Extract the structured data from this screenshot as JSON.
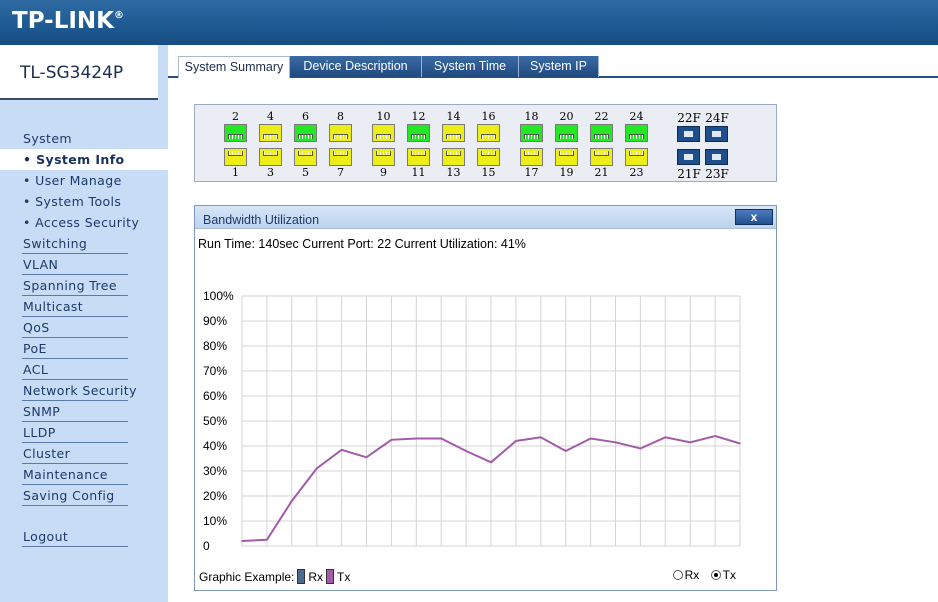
{
  "header": {
    "logo": "TP-LINK",
    "logo_reg": "®"
  },
  "sidebar": {
    "model": "TL-SG3424P",
    "items": [
      {
        "label": "System",
        "kind": "top",
        "line": false
      },
      {
        "label": "• System Info",
        "kind": "sub",
        "active": true
      },
      {
        "label": "• User Manage",
        "kind": "sub"
      },
      {
        "label": "• System Tools",
        "kind": "sub"
      },
      {
        "label": "• Access Security",
        "kind": "sub"
      },
      {
        "label": "Switching",
        "kind": "top"
      },
      {
        "label": "VLAN",
        "kind": "top"
      },
      {
        "label": "Spanning Tree",
        "kind": "top"
      },
      {
        "label": "Multicast",
        "kind": "top"
      },
      {
        "label": "QoS",
        "kind": "top"
      },
      {
        "label": "PoE",
        "kind": "top"
      },
      {
        "label": "ACL",
        "kind": "top"
      },
      {
        "label": "Network Security",
        "kind": "top"
      },
      {
        "label": "SNMP",
        "kind": "top"
      },
      {
        "label": "LLDP",
        "kind": "top"
      },
      {
        "label": "Cluster",
        "kind": "top"
      },
      {
        "label": "Maintenance",
        "kind": "top"
      },
      {
        "label": "Saving Config",
        "kind": "top"
      }
    ],
    "logout": "Logout"
  },
  "tabs": [
    {
      "label": "System Summary",
      "active": true
    },
    {
      "label": "Device Description"
    },
    {
      "label": "System Time"
    },
    {
      "label": "System IP"
    }
  ],
  "ports": {
    "top": [
      {
        "num": "2",
        "color": "green"
      },
      {
        "num": "4",
        "color": "yellow"
      },
      {
        "num": "6",
        "color": "green"
      },
      {
        "num": "8",
        "color": "yellow"
      },
      {
        "num": "10",
        "color": "yellow"
      },
      {
        "num": "12",
        "color": "green"
      },
      {
        "num": "14",
        "color": "yellow"
      },
      {
        "num": "16",
        "color": "yellow"
      },
      {
        "num": "18",
        "color": "green"
      },
      {
        "num": "20",
        "color": "green"
      },
      {
        "num": "22",
        "color": "green"
      },
      {
        "num": "24",
        "color": "green"
      }
    ],
    "bottom": [
      {
        "num": "1",
        "color": "yellow"
      },
      {
        "num": "3",
        "color": "yellow"
      },
      {
        "num": "5",
        "color": "yellow"
      },
      {
        "num": "7",
        "color": "yellow"
      },
      {
        "num": "9",
        "color": "yellow"
      },
      {
        "num": "11",
        "color": "yellow"
      },
      {
        "num": "13",
        "color": "yellow"
      },
      {
        "num": "15",
        "color": "yellow"
      },
      {
        "num": "17",
        "color": "yellow"
      },
      {
        "num": "19",
        "color": "yellow"
      },
      {
        "num": "21",
        "color": "yellow"
      },
      {
        "num": "23",
        "color": "yellow"
      }
    ],
    "sfp": {
      "top": [
        "22F",
        "24F"
      ],
      "bottom": [
        "21F",
        "23F"
      ]
    }
  },
  "bandwidth": {
    "title": "Bandwidth Utilization",
    "close_label": "x",
    "runtime": "Run Time: 140sec Current Port: 22 Current Utilization: 41%",
    "legend_label": "Graphic Example:",
    "legend_rx": "Rx",
    "legend_tx": "Tx",
    "radio_rx": "Rx",
    "radio_tx": "Tx",
    "selected": "Tx",
    "colors": {
      "rx": "#4f6a91",
      "tx": "#a35ba8"
    }
  },
  "chart_data": {
    "type": "line",
    "y_ticks": [
      "100%",
      "90%",
      "80%",
      "70%",
      "60%",
      "50%",
      "40%",
      "30%",
      "20%",
      "10%",
      "0"
    ],
    "ylim": [
      0,
      100
    ],
    "grid": true,
    "series": [
      {
        "name": "Tx",
        "values": [
          2,
          2.5,
          18,
          31,
          38.5,
          35.5,
          42.5,
          43,
          43,
          38,
          33.5,
          42,
          43.5,
          38,
          43,
          41.5,
          39,
          43.5,
          41.5,
          44,
          41
        ]
      }
    ]
  }
}
